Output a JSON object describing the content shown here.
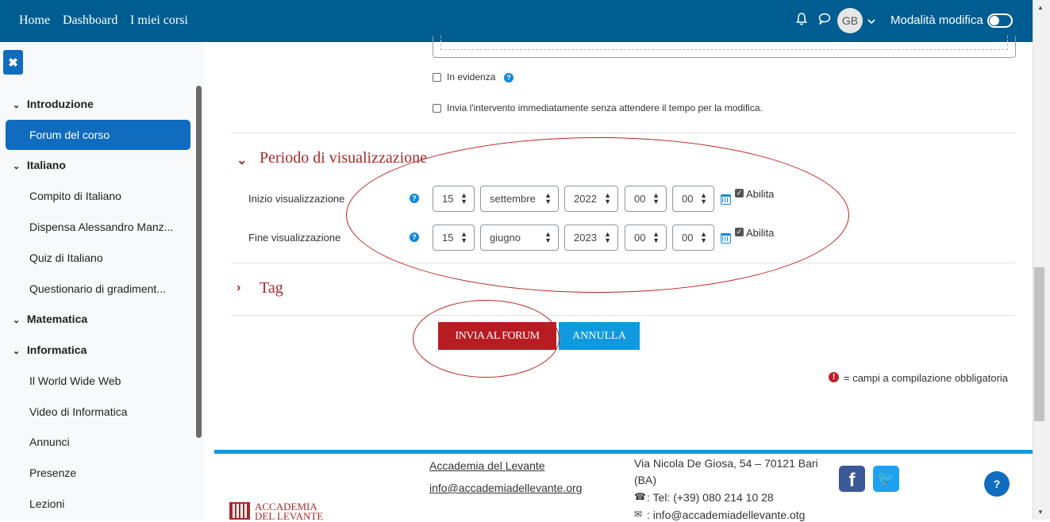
{
  "nav": {
    "links": [
      "Home",
      "Dashboard",
      "I miei corsi"
    ],
    "avatar_initials": "GB",
    "edit_mode_label": "Modalità modifica"
  },
  "sidebar": {
    "sections": [
      {
        "label": "Introduzione",
        "items": [
          "Forum del corso"
        ]
      },
      {
        "label": "Italiano",
        "items": [
          "Compito di Italiano",
          "Dispensa Alessandro Manz...",
          "Quiz di Italiano",
          "Questionario di gradiment..."
        ]
      },
      {
        "label": "Matematica",
        "items": []
      },
      {
        "label": "Informatica",
        "items": [
          "Il World Wide Web",
          "Video di Informatica",
          "Annunci",
          "Presenze",
          "Lezioni"
        ]
      }
    ],
    "active_item": "Forum del corso"
  },
  "form": {
    "pinned_label": "In evidenza",
    "mail_now_label": "Invia l'intervento immediatamente senza attendere il tempo per la modifica.",
    "display_period": {
      "legend": "Periodo di visualizzazione",
      "start": {
        "label": "Inizio visualizzazione",
        "day": "15",
        "month": "settembre",
        "year": "2022",
        "hour": "00",
        "minute": "00",
        "enable_label": "Abilita"
      },
      "end": {
        "label": "Fine visualizzazione",
        "day": "15",
        "month": "giugno",
        "year": "2023",
        "hour": "00",
        "minute": "00",
        "enable_label": "Abilita"
      }
    },
    "tags_legend": "Tag",
    "submit_label": "INVIA AL FORUM",
    "cancel_label": "ANNULLA",
    "required_note": "= campi a compilazione obbligatoria"
  },
  "footer": {
    "org_name": "Accademia del Levante",
    "email_link": "info@accademiadellevante.org",
    "address": "Via Nicola De Giosa, 54 – 70121 Bari",
    "province": "(BA)",
    "phone": ": Tel: (+39) 080 214 10 28",
    "email_contact": ": info@accademiadellevante.otg",
    "logo_line1": "ACCADEMIA",
    "logo_line2": "DEL LEVANTE",
    "facebook_glyph": "f",
    "twitter_glyph": "🐦",
    "help_glyph": "?"
  },
  "colors": {
    "navbar": "#005d91",
    "accent_red": "#b81c23",
    "accent_blue": "#0f9ae0",
    "active_item": "#0f6cbf"
  }
}
